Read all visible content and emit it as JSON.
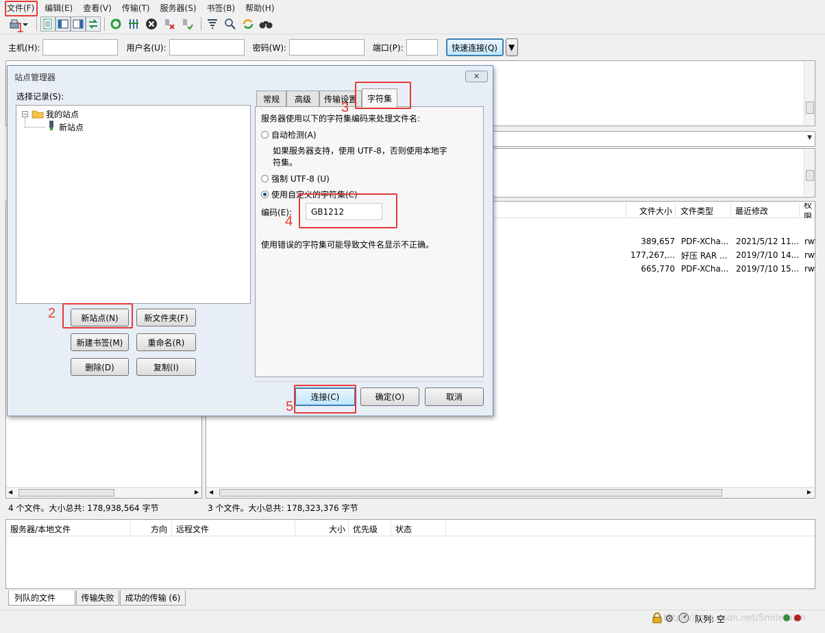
{
  "menu": [
    "文件(F)",
    "编辑(E)",
    "查看(V)",
    "传输(T)",
    "服务器(S)",
    "书签(B)",
    "帮助(H)"
  ],
  "quickconnect": {
    "host_label": "主机(H):",
    "user_label": "用户名(U):",
    "pass_label": "密码(W):",
    "port_label": "端口(P):",
    "button": "快速连接(Q)"
  },
  "remote_list": {
    "columns": [
      "文件大小",
      "文件类型",
      "最近修改",
      "权限"
    ],
    "rows": [
      {
        "size": "389,657",
        "type": "PDF-XCha...",
        "modified": "2021/5/12 11...",
        "perm": "rwt"
      },
      {
        "size": "177,267,...",
        "type": "好压 RAR ...",
        "modified": "2019/7/10 14...",
        "perm": "rwt"
      },
      {
        "size": "665,770",
        "type": "PDF-XCha...",
        "modified": "2019/7/10 15...",
        "perm": "rwt"
      }
    ]
  },
  "status": {
    "local": "4 个文件。大小总共: 178,938,564 字节",
    "remote": "3 个文件。大小总共: 178,323,376 字节"
  },
  "queue": {
    "columns": [
      "服务器/本地文件",
      "方向",
      "远程文件",
      "大小",
      "优先级",
      "状态"
    ],
    "tabs": [
      "列队的文件",
      "传输失败",
      "成功的传输 (6)"
    ],
    "queue_status": "队列: 空",
    "watermark": "https://blog.csdn.net/SmileToLin"
  },
  "dialog": {
    "title": "站点管理器",
    "select_label": "选择记录(S):",
    "tree": {
      "root": "我的站点",
      "child": "新站点"
    },
    "buttons": {
      "new_site": "新站点(N)",
      "new_folder": "新文件夹(F)",
      "new_bookmark": "新建书签(M)",
      "rename": "重命名(R)",
      "delete": "删除(D)",
      "copy": "复制(I)",
      "connect": "连接(C)",
      "ok": "确定(O)",
      "cancel": "取消"
    },
    "tabs": [
      "常规",
      "高级",
      "传输设置",
      "字符集"
    ],
    "charset": {
      "intro": "服务器使用以下的字符集编码来处理文件名:",
      "auto_detect": "自动检测(A)",
      "auto_desc_1": "如果服务器支持，使用 UTF-8，否则使用本地字",
      "auto_desc_2": "符集。",
      "force_utf8": "强制 UTF-8 (U)",
      "custom": "使用自定义的字符集(C)",
      "encoding_label": "编码(E):",
      "encoding_value": "GB1212",
      "warning": "使用错误的字符集可能导致文件名显示不正确。"
    }
  },
  "annotations": [
    "1",
    "2",
    "3",
    "4",
    "5"
  ],
  "colors": {
    "accent": "#e53935",
    "selected_tab": "#f7f7f7",
    "dialog_bg": "#e8eef6"
  }
}
